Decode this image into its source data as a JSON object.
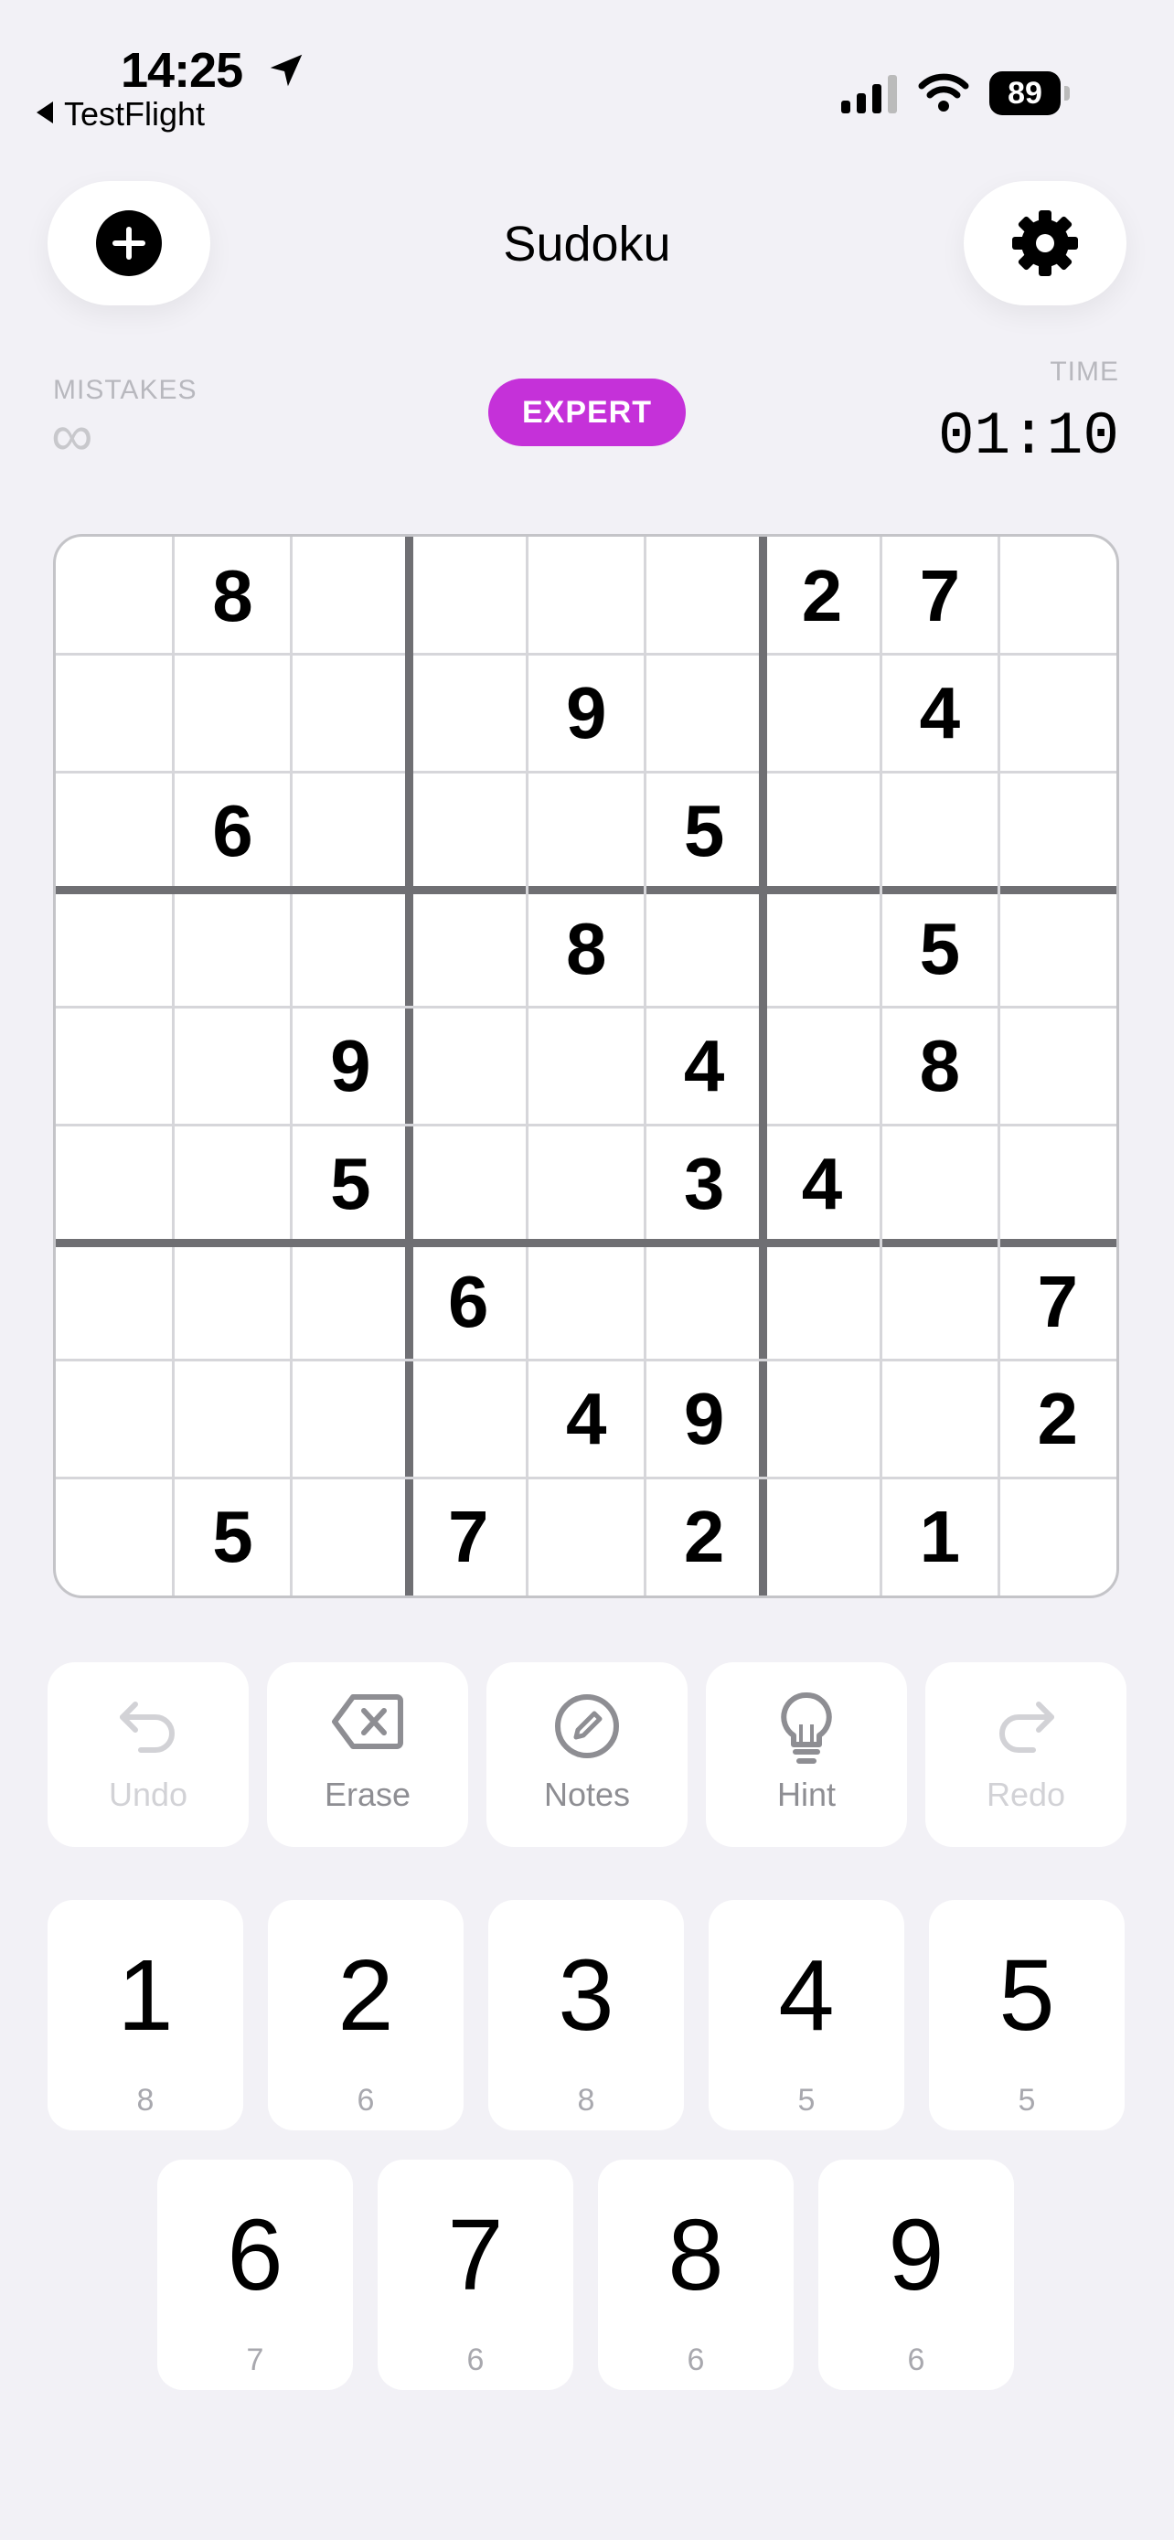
{
  "status": {
    "time": "14:25",
    "back_app": "TestFlight",
    "battery": "89"
  },
  "header": {
    "title": "Sudoku",
    "add_icon": "plus-circle-icon",
    "settings_icon": "gear-icon"
  },
  "info": {
    "mistakes_label": "MISTAKES",
    "mistakes_value": "∞",
    "difficulty": "EXPERT",
    "time_label": "TIME",
    "time_value": "01:10"
  },
  "colors": {
    "accent": "#c531d9",
    "background": "#f2f1f6"
  },
  "board": {
    "rows": [
      [
        "",
        "8",
        "",
        "",
        "",
        "",
        "2",
        "7",
        ""
      ],
      [
        "",
        "",
        "",
        "",
        "9",
        "",
        "",
        "4",
        ""
      ],
      [
        "",
        "6",
        "",
        "",
        "",
        "5",
        "",
        "",
        ""
      ],
      [
        "",
        "",
        "",
        "",
        "8",
        "",
        "",
        "5",
        ""
      ],
      [
        "",
        "",
        "9",
        "",
        "",
        "4",
        "",
        "8",
        ""
      ],
      [
        "",
        "",
        "5",
        "",
        "",
        "3",
        "4",
        "",
        ""
      ],
      [
        "",
        "",
        "",
        "6",
        "",
        "",
        "",
        "",
        "7"
      ],
      [
        "",
        "",
        "",
        "",
        "4",
        "9",
        "",
        "",
        "2"
      ],
      [
        "",
        "5",
        "",
        "7",
        "",
        "2",
        "",
        "1",
        ""
      ]
    ]
  },
  "tools": [
    {
      "label": "Undo",
      "icon": "undo-icon",
      "enabled": false
    },
    {
      "label": "Erase",
      "icon": "erase-icon",
      "enabled": true
    },
    {
      "label": "Notes",
      "icon": "pencil-icon",
      "enabled": true
    },
    {
      "label": "Hint",
      "icon": "lightbulb-icon",
      "enabled": true
    },
    {
      "label": "Redo",
      "icon": "redo-icon",
      "enabled": false
    }
  ],
  "numpad": [
    {
      "digit": "1",
      "count": "8"
    },
    {
      "digit": "2",
      "count": "6"
    },
    {
      "digit": "3",
      "count": "8"
    },
    {
      "digit": "4",
      "count": "5"
    },
    {
      "digit": "5",
      "count": "5"
    },
    {
      "digit": "6",
      "count": "7"
    },
    {
      "digit": "7",
      "count": "6"
    },
    {
      "digit": "8",
      "count": "6"
    },
    {
      "digit": "9",
      "count": "6"
    }
  ]
}
